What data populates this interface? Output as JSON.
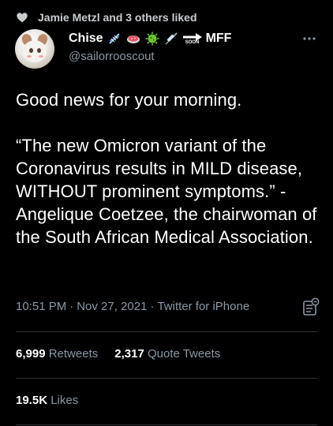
{
  "social_context": {
    "icon": "heart-icon",
    "text": "Jamie Metzl and 3 others liked"
  },
  "author": {
    "display_name": "Chise",
    "name_emojis": [
      "dna-emoji",
      "petri-dish-emoji",
      "microbe-emoji",
      "syringe-emoji",
      "soon-arrow-emoji"
    ],
    "soon_label": "SOON",
    "name_suffix": "MFF",
    "handle": "@sailorrooscout"
  },
  "tweet": {
    "paragraphs": [
      "Good news for your morning.",
      "“The new Omicron variant of the Coronavirus results in MILD disease, WITHOUT prominent symptoms.” -Angelique Coetzee, the chairwoman of the South African Medical Association."
    ],
    "time": "10:51 PM",
    "date": "Nov 27, 2021",
    "source": "Twitter for iPhone",
    "separator": "·"
  },
  "stats": {
    "retweets_count": "6,999",
    "retweets_label": "Retweets",
    "quote_count": "2,317",
    "quote_label": "Quote Tweets",
    "likes_count": "19.5K",
    "likes_label": "Likes"
  },
  "colors": {
    "background": "#000000",
    "primary_text": "#ffffff",
    "secondary_text": "#8b98a5",
    "divider": "#2f3336"
  }
}
